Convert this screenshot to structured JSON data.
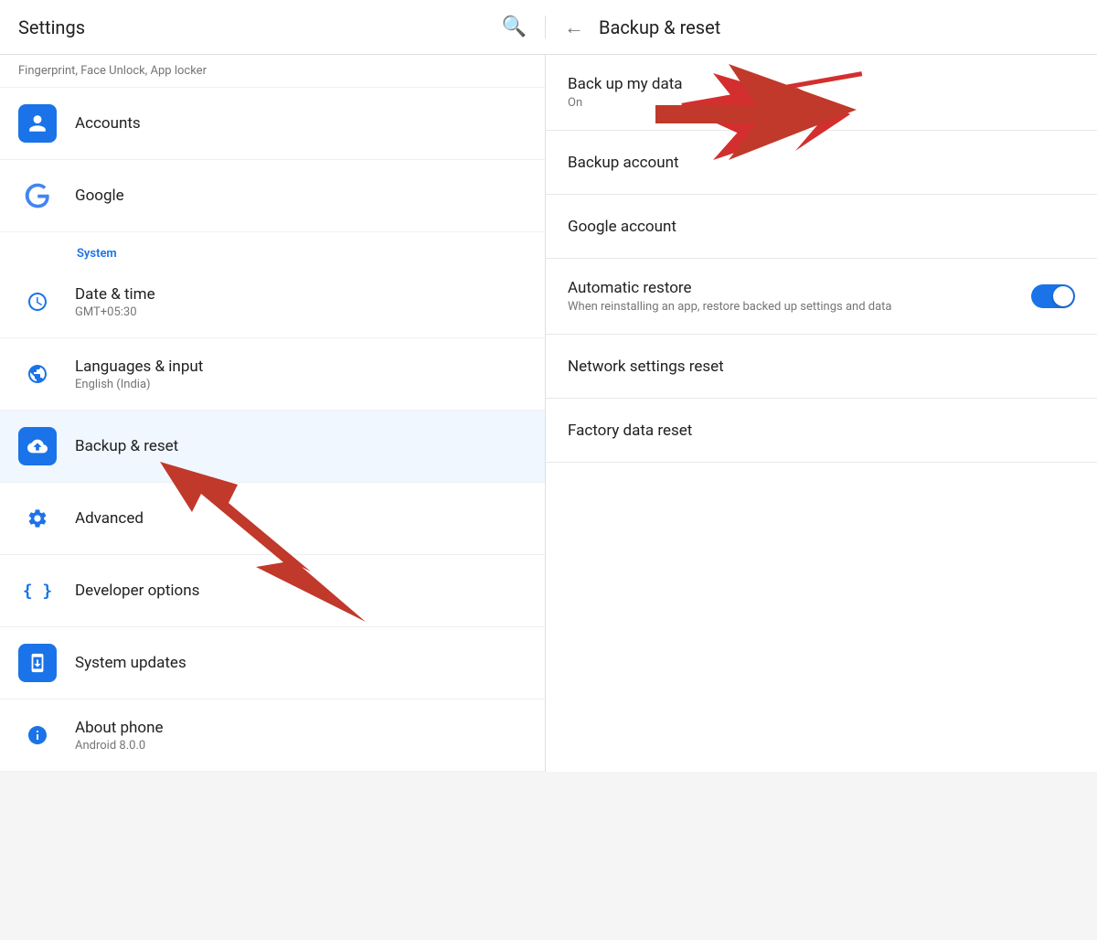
{
  "topbar": {
    "left_title": "Settings",
    "right_title": "Backup & reset",
    "search_icon": "🔍",
    "back_icon": "←"
  },
  "sidebar": {
    "top_label": "Fingerprint, Face Unlock, App locker",
    "section_system": "System",
    "items": [
      {
        "id": "accounts",
        "icon": "👤",
        "icon_type": "blue",
        "title": "Accounts",
        "sub": ""
      },
      {
        "id": "google",
        "icon": "G",
        "icon_type": "google",
        "title": "Google",
        "sub": ""
      },
      {
        "id": "date-time",
        "icon": "🕐",
        "icon_type": "outline",
        "title": "Date & time",
        "sub": "GMT+05:30"
      },
      {
        "id": "languages",
        "icon": "🌐",
        "icon_type": "outline",
        "title": "Languages & input",
        "sub": "English (India)"
      },
      {
        "id": "backup-reset",
        "icon": "☁",
        "icon_type": "blue-upload",
        "title": "Backup & reset",
        "sub": ""
      },
      {
        "id": "advanced",
        "icon": "⚙",
        "icon_type": "outline",
        "title": "Advanced",
        "sub": ""
      },
      {
        "id": "developer",
        "icon": "{}",
        "icon_type": "outline",
        "title": "Developer options",
        "sub": ""
      },
      {
        "id": "system-updates",
        "icon": "📲",
        "icon_type": "blue",
        "title": "System updates",
        "sub": ""
      },
      {
        "id": "about",
        "icon": "ℹ",
        "icon_type": "outline",
        "title": "About phone",
        "sub": "Android 8.0.0"
      }
    ]
  },
  "detail": {
    "items": [
      {
        "id": "back-up-data",
        "title": "Back up my data",
        "sub": "On",
        "has_toggle": false
      },
      {
        "id": "backup-account",
        "title": "Backup account",
        "sub": "",
        "has_toggle": false
      },
      {
        "id": "google-account",
        "title": "Google account",
        "sub": "",
        "has_toggle": false
      },
      {
        "id": "automatic-restore",
        "title": "Automatic restore",
        "sub": "When reinstalling an app, restore backed up settings and data",
        "has_toggle": true
      },
      {
        "id": "network-settings-reset",
        "title": "Network settings reset",
        "sub": "",
        "has_toggle": false
      },
      {
        "id": "factory-data-reset",
        "title": "Factory data reset",
        "sub": "",
        "has_toggle": false
      }
    ]
  }
}
